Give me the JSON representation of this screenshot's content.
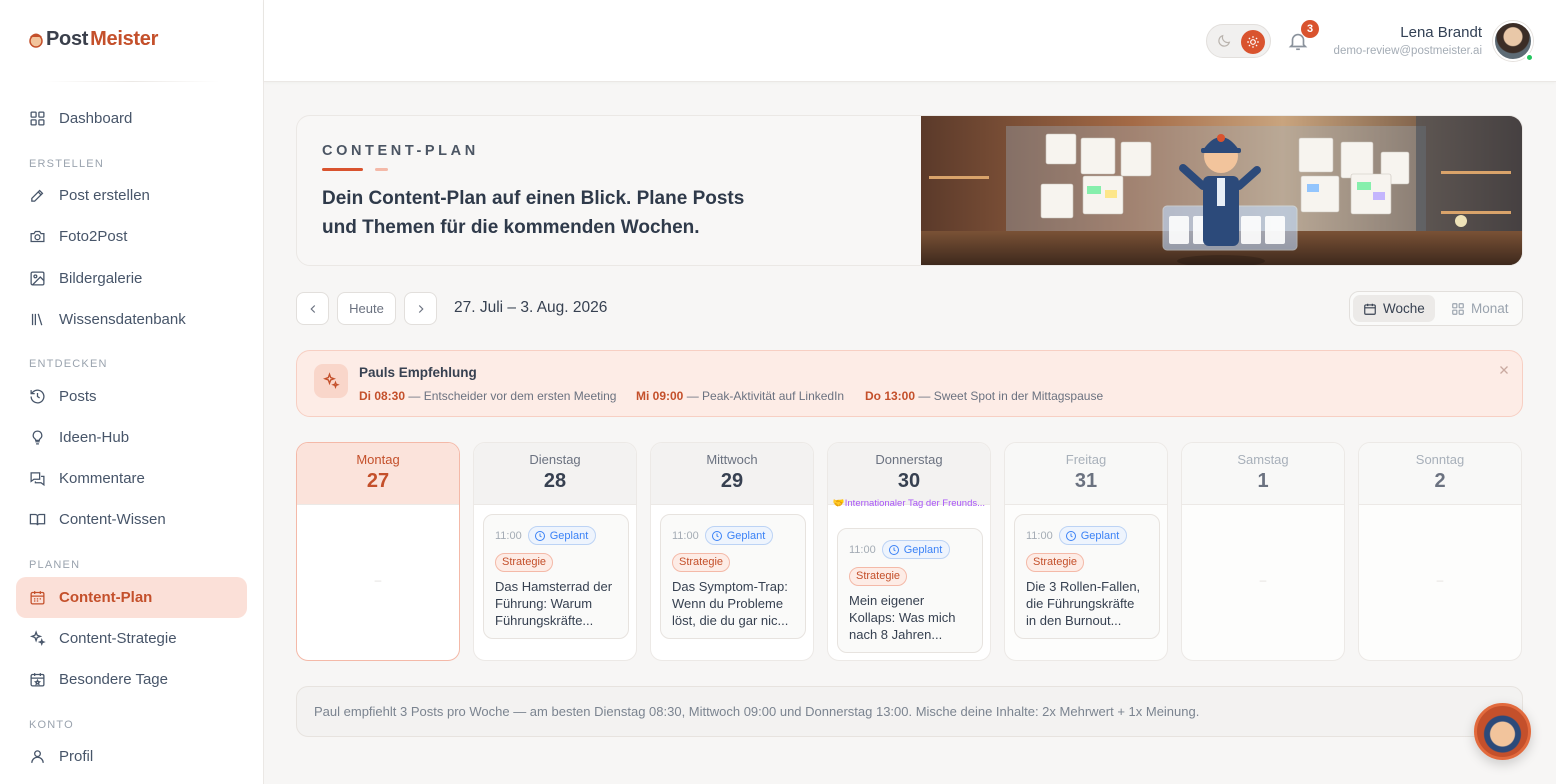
{
  "brand": {
    "part1": "Post",
    "part2": "Meister"
  },
  "sidebar": {
    "items_top": [
      {
        "label": "Dashboard",
        "icon": "dashboard-icon"
      }
    ],
    "sections": [
      {
        "title": "ERSTELLEN",
        "items": [
          {
            "label": "Post erstellen",
            "icon": "pen-icon"
          },
          {
            "label": "Foto2Post",
            "icon": "camera-icon"
          },
          {
            "label": "Bildergalerie",
            "icon": "image-icon"
          },
          {
            "label": "Wissensdatenbank",
            "icon": "library-icon"
          }
        ]
      },
      {
        "title": "ENTDECKEN",
        "items": [
          {
            "label": "Posts",
            "icon": "history-icon"
          },
          {
            "label": "Ideen-Hub",
            "icon": "lightbulb-icon"
          },
          {
            "label": "Kommentare",
            "icon": "comments-icon"
          },
          {
            "label": "Content-Wissen",
            "icon": "book-icon"
          }
        ]
      },
      {
        "title": "PLANEN",
        "items": [
          {
            "label": "Content-Plan",
            "icon": "calendar-icon",
            "active": true
          },
          {
            "label": "Content-Strategie",
            "icon": "sparkles-icon"
          },
          {
            "label": "Besondere Tage",
            "icon": "calendar-star-icon"
          }
        ]
      },
      {
        "title": "KONTO",
        "items": [
          {
            "label": "Profil",
            "icon": "user-icon"
          }
        ]
      }
    ]
  },
  "header": {
    "notifications_count": "3",
    "user_name": "Lena Brandt",
    "user_email": "demo-review@postmeister.ai",
    "theme": "light"
  },
  "hero": {
    "kicker": "CONTENT-PLAN",
    "text": "Dein Content-Plan auf einen Blick. Plane Posts und Themen für die kommenden Wochen."
  },
  "week_nav": {
    "today_label": "Heute",
    "range": "27. Juli – 3. Aug. 2026",
    "view_week": "Woche",
    "view_month": "Monat"
  },
  "recommendation": {
    "title": "Pauls Empfehlung",
    "slots": [
      {
        "time": "Di 08:30",
        "text": " — Entscheider vor dem ersten Meeting"
      },
      {
        "time": "Mi 09:00",
        "text": " — Peak-Aktivität auf LinkedIn"
      },
      {
        "time": "Do 13:00",
        "text": " — Sweet Spot in der Mittagspause"
      }
    ]
  },
  "days": [
    {
      "name": "Montag",
      "num": "27",
      "empty_marker": "–"
    },
    {
      "name": "Dienstag",
      "num": "28",
      "post": {
        "time": "11:00",
        "status": "Geplant",
        "tag": "Strategie",
        "title": "Das Hamsterrad der Führung: Warum Führungskräfte..."
      }
    },
    {
      "name": "Mittwoch",
      "num": "29",
      "post": {
        "time": "11:00",
        "status": "Geplant",
        "tag": "Strategie",
        "title": "Das Symptom-Trap: Wenn du Probleme löst, die du gar nic..."
      }
    },
    {
      "name": "Donnerstag",
      "num": "30",
      "special": "🤝Internationaler Tag der Freunds...",
      "post": {
        "time": "11:00",
        "status": "Geplant",
        "tag": "Strategie",
        "title": "Mein eigener Kollaps: Was mich nach 8 Jahren..."
      }
    },
    {
      "name": "Freitag",
      "num": "31",
      "post": {
        "time": "11:00",
        "status": "Geplant",
        "tag": "Strategie",
        "title": "Die 3 Rollen-Fallen, die Führungskräfte in den Burnout..."
      }
    },
    {
      "name": "Samstag",
      "num": "1",
      "empty_marker": "–"
    },
    {
      "name": "Sonntag",
      "num": "2",
      "empty_marker": "–"
    }
  ],
  "footer_note": "Paul empfiehlt 3 Posts pro Woche — am besten Dienstag 08:30, Mittwoch 09:00 und Donnerstag 13:00. Mische deine Inhalte: 2x Mehrwert + 1x Meinung.",
  "colors": {
    "accent": "#d9532e",
    "accent_dark": "#c4502b",
    "status_blue": "#3b82f6",
    "special_purple": "#a855f7"
  }
}
